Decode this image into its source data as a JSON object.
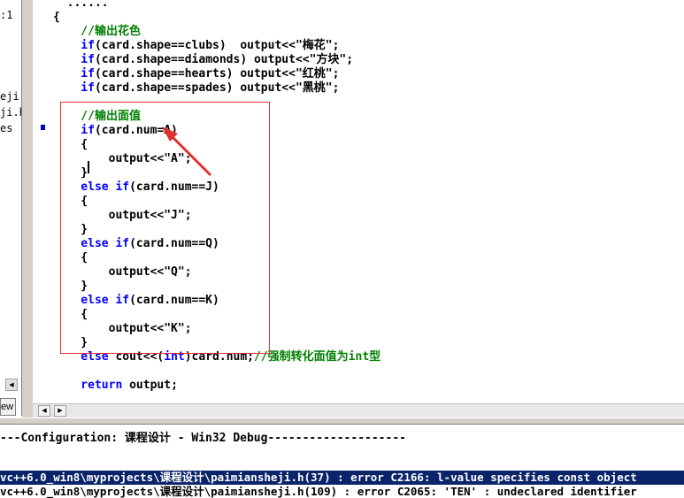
{
  "left_panel": {
    "tree_items": [
      ":1",
      "eji.l",
      "ji.h",
      "es"
    ],
    "tab_label": "ew"
  },
  "editor": {
    "lines": [
      {
        "parts": [
          {
            "t": "plain",
            "v": "  ......  "
          }
        ]
      },
      {
        "parts": [
          {
            "t": "plain",
            "v": "{"
          }
        ]
      },
      {
        "parts": [
          {
            "t": "comment",
            "v": "    //输出花色"
          }
        ]
      },
      {
        "parts": [
          {
            "t": "keyword",
            "v": "    if"
          },
          {
            "t": "plain",
            "v": "(card.shape==clubs)  output<<\"梅花\";"
          }
        ]
      },
      {
        "parts": [
          {
            "t": "keyword",
            "v": "    if"
          },
          {
            "t": "plain",
            "v": "(card.shape==diamonds) output<<\"方块\";"
          }
        ]
      },
      {
        "parts": [
          {
            "t": "keyword",
            "v": "    if"
          },
          {
            "t": "plain",
            "v": "(card.shape==hearts) output<<\"红桃\";"
          }
        ]
      },
      {
        "parts": [
          {
            "t": "keyword",
            "v": "    if"
          },
          {
            "t": "plain",
            "v": "(card.shape==spades) output<<\"黑桃\";"
          }
        ]
      },
      {
        "parts": []
      },
      {
        "parts": [
          {
            "t": "comment",
            "v": "    //输出面值"
          }
        ]
      },
      {
        "parts": [
          {
            "t": "keyword",
            "v": "    if"
          },
          {
            "t": "plain",
            "v": "(card.num=A)"
          }
        ]
      },
      {
        "parts": [
          {
            "t": "plain",
            "v": "    {"
          }
        ]
      },
      {
        "parts": [
          {
            "t": "plain",
            "v": "        output<<\"A\";"
          }
        ]
      },
      {
        "parts": [
          {
            "t": "plain",
            "v": "    }"
          }
        ]
      },
      {
        "parts": [
          {
            "t": "keyword",
            "v": "    else if"
          },
          {
            "t": "plain",
            "v": "(card.num==J)"
          }
        ]
      },
      {
        "parts": [
          {
            "t": "plain",
            "v": "    {"
          }
        ]
      },
      {
        "parts": [
          {
            "t": "plain",
            "v": "        output<<\"J\";"
          }
        ]
      },
      {
        "parts": [
          {
            "t": "plain",
            "v": "    }"
          }
        ]
      },
      {
        "parts": [
          {
            "t": "keyword",
            "v": "    else if"
          },
          {
            "t": "plain",
            "v": "(card.num==Q)"
          }
        ]
      },
      {
        "parts": [
          {
            "t": "plain",
            "v": "    {"
          }
        ]
      },
      {
        "parts": [
          {
            "t": "plain",
            "v": "        output<<\"Q\";"
          }
        ]
      },
      {
        "parts": [
          {
            "t": "plain",
            "v": "    }"
          }
        ]
      },
      {
        "parts": [
          {
            "t": "keyword",
            "v": "    else if"
          },
          {
            "t": "plain",
            "v": "(card.num==K)"
          }
        ]
      },
      {
        "parts": [
          {
            "t": "plain",
            "v": "    {"
          }
        ]
      },
      {
        "parts": [
          {
            "t": "plain",
            "v": "        output<<\"K\";"
          }
        ]
      },
      {
        "parts": [
          {
            "t": "plain",
            "v": "    }"
          }
        ]
      },
      {
        "parts": [
          {
            "t": "keyword",
            "v": "    else"
          },
          {
            "t": "plain",
            "v": " cout<<("
          },
          {
            "t": "keyword",
            "v": "int"
          },
          {
            "t": "plain",
            "v": ")card.num;"
          },
          {
            "t": "comment",
            "v": "//强制转化面值为int型"
          }
        ]
      },
      {
        "parts": []
      },
      {
        "parts": [
          {
            "t": "keyword",
            "v": "    return"
          },
          {
            "t": "plain",
            "v": " output;"
          }
        ]
      }
    ]
  },
  "output": {
    "config_line": "---Configuration: 课程设计 - Win32 Debug--------------------",
    "error_line_1": "vc++6.0_win8\\myprojects\\课程设计\\paimiansheji.h(37) : error C2166: l-value specifies const object",
    "error_line_2": "vc++6.0_win8\\myprojects\\课程设计\\paimiansheji.h(109) : error C2065: 'TEN' : undeclared identifier"
  },
  "colors": {
    "keyword": "#0000ff",
    "comment": "#008000",
    "annotation": "#e03030",
    "error_highlight": "#0a246a"
  },
  "icons": {
    "exec_marker": "current-line-arrow-icon",
    "annotation_arrow": "red-arrow-icon"
  }
}
